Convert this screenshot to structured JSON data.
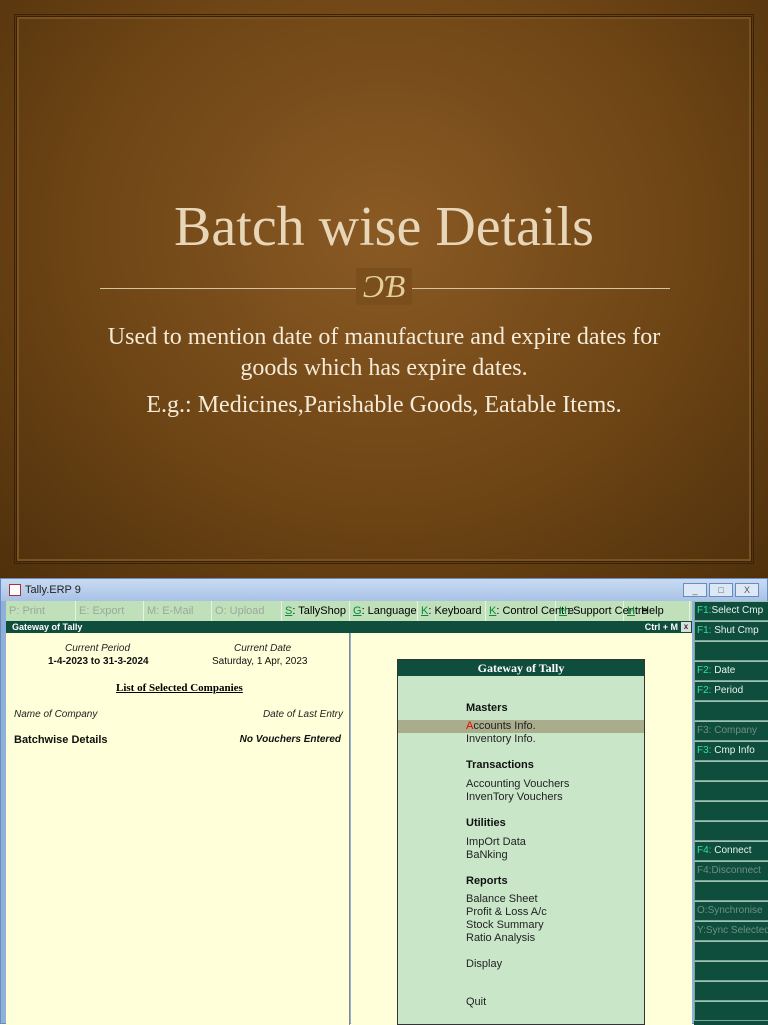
{
  "slide": {
    "title": "Batch wise Details",
    "flourish": "ƆƁ",
    "paragraphs": [
      "Used to mention date of manufacture and expire dates for goods which has expire dates.",
      "E.g.: Medicines,Parishable Goods, Eatable Items."
    ]
  },
  "window": {
    "title": "Tally.ERP 9",
    "buttons": [
      "_",
      "□",
      "X"
    ]
  },
  "menu": [
    {
      "key": "P",
      "label": ": Print",
      "disabled": true
    },
    {
      "key": "E",
      "label": ": Export",
      "disabled": true
    },
    {
      "key": "M",
      "label": ": E-Mail",
      "disabled": true
    },
    {
      "key": "O",
      "label": ": Upload",
      "disabled": true
    },
    {
      "key": "S",
      "label": ": TallyShop",
      "disabled": false
    },
    {
      "key": "G",
      "label": ": Language",
      "disabled": false
    },
    {
      "key": "K",
      "label": ": Keyboard",
      "disabled": false
    },
    {
      "key": "K",
      "label": ": Control Centre",
      "disabled": false
    },
    {
      "key": "H",
      "label": ": Support Centre",
      "disabled": false
    },
    {
      "key": "H",
      "label": ": Help",
      "disabled": false
    }
  ],
  "gateway_bar": {
    "title": "Gateway of Tally",
    "shortcut": "Ctrl + M",
    "close": "x"
  },
  "left": {
    "period_label": "Current Period",
    "period": "1-4-2023 to 31-3-2024",
    "date_label": "Current Date",
    "date": "Saturday, 1 Apr, 2023",
    "list_title": "List of Selected Companies",
    "col_name": "Name of Company",
    "col_date": "Date of Last Entry",
    "company": "Batchwise Details",
    "last_entry": "No Vouchers Entered"
  },
  "gateway": {
    "title": "Gateway of Tally",
    "masters": "Masters",
    "accounts_key": "A",
    "accounts": "ccounts Info.",
    "inventory": "Inventory Info.",
    "transactions": "Transactions",
    "acc_vouchers": "Accounting Vouchers",
    "inv_vouchers": "InvenTory Vouchers",
    "utilities": "Utilities",
    "import": "ImpOrt Data",
    "banking": "BaNking",
    "reports": "Reports",
    "balance": "Balance Sheet",
    "pl": "Profit & Loss A/c",
    "stock": "Stock Summary",
    "ratio": "Ratio Analysis",
    "display": "Display",
    "quit": "Quit"
  },
  "side": [
    {
      "key": "F1:",
      "label": "Select Cmp",
      "disabled": false
    },
    {
      "key": "F1:",
      "label": " Shut Cmp",
      "disabled": false
    },
    {
      "key": "",
      "label": "",
      "disabled": false
    },
    {
      "key": "F2:",
      "label": " Date",
      "disabled": false
    },
    {
      "key": "F2:",
      "label": " Period",
      "disabled": false
    },
    {
      "key": "",
      "label": "",
      "disabled": false
    },
    {
      "key": "F3:",
      "label": " Company",
      "disabled": true
    },
    {
      "key": "F3:",
      "label": " Cmp Info",
      "disabled": false
    },
    {
      "key": "",
      "label": "",
      "disabled": false
    },
    {
      "key": "",
      "label": "",
      "disabled": false
    },
    {
      "key": "",
      "label": "",
      "disabled": false
    },
    {
      "key": "",
      "label": "",
      "disabled": false
    },
    {
      "key": "F4:",
      "label": " Connect",
      "disabled": false
    },
    {
      "key": "F4:",
      "label": "Disconnect",
      "disabled": true
    },
    {
      "key": "",
      "label": "",
      "disabled": false
    },
    {
      "key": "O:",
      "label": "Synchronise",
      "disabled": true
    },
    {
      "key": "Y:",
      "label": "Sync Selected",
      "disabled": true
    },
    {
      "key": "",
      "label": "",
      "disabled": false
    },
    {
      "key": "",
      "label": "",
      "disabled": false
    },
    {
      "key": "",
      "label": "",
      "disabled": false
    },
    {
      "key": "",
      "label": "",
      "disabled": false
    }
  ]
}
